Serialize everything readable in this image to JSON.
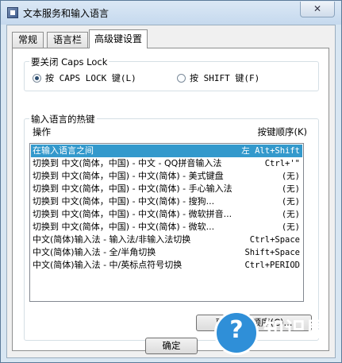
{
  "window": {
    "title": "文本服务和输入语言",
    "close_glyph": "✕"
  },
  "tabs": [
    {
      "label": "常规"
    },
    {
      "label": "语言栏"
    },
    {
      "label": "高级键设置"
    }
  ],
  "caps_lock": {
    "label": "要关闭 Caps Lock",
    "option_caps": "按 CAPS LOCK 键(L)",
    "option_shift": "按 SHIFT 键(F)",
    "selected": "caps"
  },
  "hotkeys": {
    "label": "输入语言的热键",
    "col_action": "操作",
    "col_key": "按键顺序(K)",
    "rows": [
      {
        "action": "在输入语言之间",
        "key": "左 Alt+Shift",
        "selected": true
      },
      {
        "action": "切换到 中文(简体，中国) - 中文 - QQ拼音输入法",
        "key": "Ctrl+'\""
      },
      {
        "action": "切换到 中文(简体，中国) - 中文(简体) - 美式键盘",
        "key": "(无)"
      },
      {
        "action": "切换到 中文(简体，中国) - 中文(简体) - 手心输入法",
        "key": "(无)"
      },
      {
        "action": "切换到 中文(简体，中国) - 中文(简体) - 搜狗...",
        "key": "(无)"
      },
      {
        "action": "切换到 中文(简体，中国) - 中文(简体) - 微软拼音...",
        "key": "(无)"
      },
      {
        "action": "切换到 中文(简体，中国) - 中文(简体) - 微软...",
        "key": "(无)"
      },
      {
        "action": "中文(简体)输入法 - 输入法/非输入法切换",
        "key": "Ctrl+Space"
      },
      {
        "action": "中文(简体)输入法 - 全/半角切换",
        "key": "Shift+Space"
      },
      {
        "action": "中文(简体)输入法 - 中/英标点符号切换",
        "key": "Ctrl+PERIOD"
      }
    ],
    "change_button": "更改按键顺序(C)..."
  },
  "footer": {
    "ok_button": "确定"
  },
  "watermark": {
    "title": "知识屋",
    "subtitle": "zhishiwu.com",
    "glyph": "?"
  }
}
